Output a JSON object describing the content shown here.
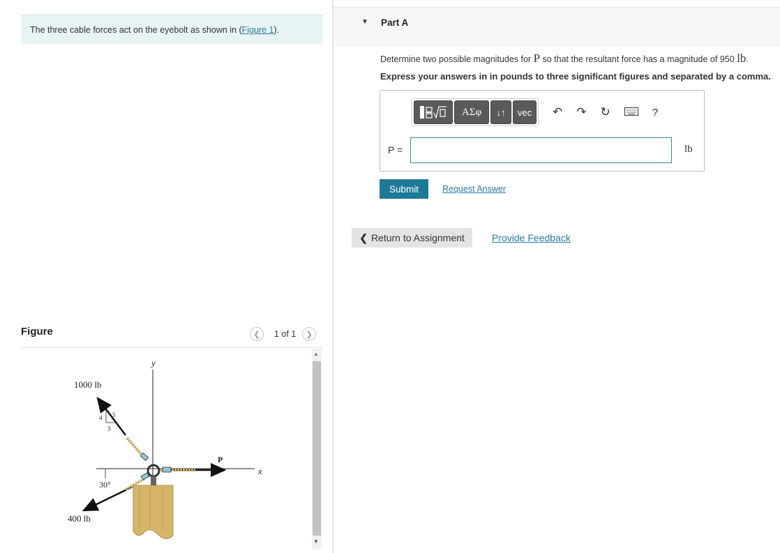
{
  "intro": {
    "text": "The three cable forces act on the eyebolt as shown in (",
    "link": "Figure 1",
    "suffix": ")."
  },
  "figure": {
    "title": "Figure",
    "pager": "1 of 1",
    "labels": {
      "y_axis": "y",
      "x_axis": "x",
      "force_top": "1000 lb",
      "force_bottom": "400 lb",
      "force_right": "P",
      "angle": "30°",
      "tri_hyp": "5",
      "tri_vert": "4",
      "tri_horiz": "3"
    },
    "colors": {
      "rope": "#c9a96a",
      "block": "#d6b46a",
      "hook": "#8ec7d6"
    }
  },
  "part": {
    "title": "Part A",
    "question_pre": "Determine two possible magnitudes for ",
    "question_var": "P",
    "question_post": " so that the resultant force has a magnitude of 950 ",
    "question_unit": "lb",
    "question_end": ".",
    "instruction": "Express your answers in in pounds to three significant figures and separated by a comma."
  },
  "toolbar": {
    "greek": "ΑΣφ",
    "arrows": "↓↑",
    "vec": "vec",
    "help": "?"
  },
  "answer": {
    "label": "P =",
    "value": "",
    "unit": "lb"
  },
  "actions": {
    "submit": "Submit",
    "request": "Request Answer",
    "return": "Return to Assignment",
    "feedback": "Provide Feedback"
  }
}
